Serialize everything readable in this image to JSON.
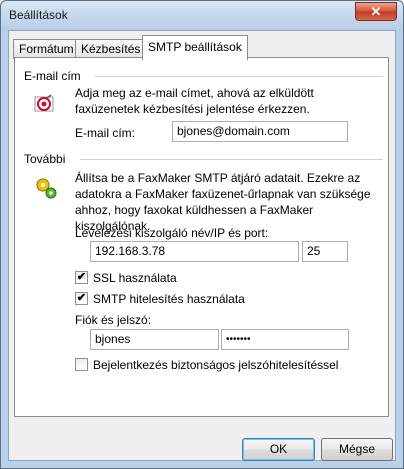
{
  "window": {
    "title": "Beállítások",
    "close_glyph": "✕"
  },
  "tabs": [
    {
      "label": "Formátum"
    },
    {
      "label": "Kézbesítés"
    },
    {
      "label": "SMTP beállítások"
    }
  ],
  "email_section": {
    "heading": "E-mail cím",
    "description": "Adja meg az e-mail címet, ahová az elküldött faxüzenetek kézbesítési jelentése érkezzen.",
    "field_label": "E-mail cím:",
    "field_value": "bjones@domain.com",
    "icon": "target-mail-icon"
  },
  "more_section": {
    "heading": "További",
    "description": "Állítsa be a FaxMaker SMTP átjáró adatait. Ezekre az adatokra a FaxMaker faxüzenet-űrlapnak van szüksége ahhoz, hogy faxokat küldhessen a FaxMaker kiszolgálónak.",
    "server_label": "Levelezési kiszolgáló név/IP és port:",
    "server_value": "192.168.3.78",
    "port_value": "25",
    "ssl_label": "SSL használata",
    "ssl_checked": true,
    "auth_label": "SMTP hitelesítés használata",
    "auth_checked": true,
    "account_label": "Fiók és jelszó:",
    "account_value": "bjones",
    "password_value": "•••••••",
    "secure_label": "Bejelentkezés biztonságos jelszóhitelesítéssel",
    "secure_checked": false,
    "icon": "gears-icon"
  },
  "buttons": {
    "ok": "OK",
    "cancel": "Mégse"
  },
  "check_glyph": "✔"
}
